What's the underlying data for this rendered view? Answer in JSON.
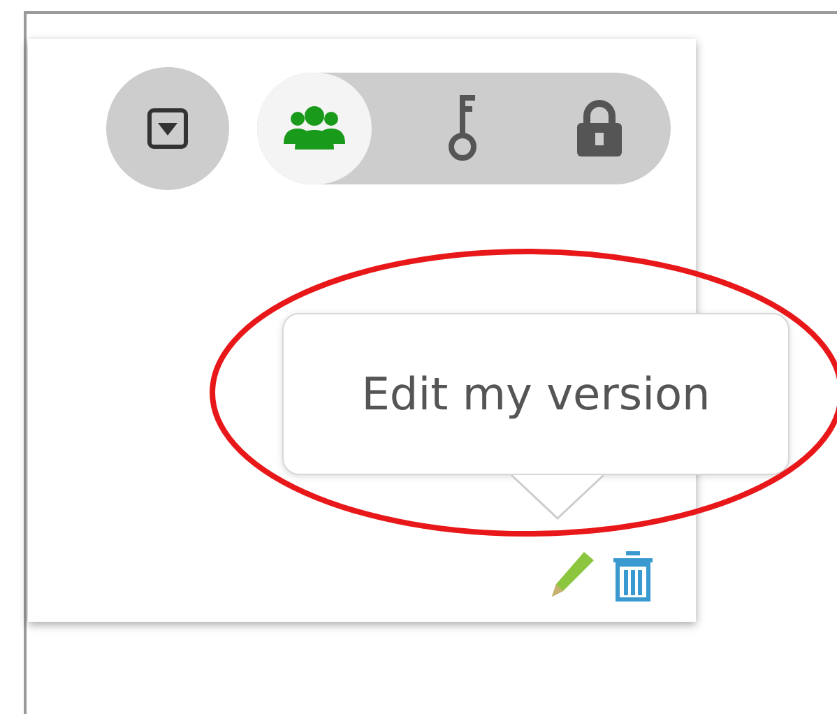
{
  "toolbar": {
    "menu_button": {
      "kind": "dropdown"
    },
    "toggles": [
      {
        "kind": "people",
        "selected": true
      },
      {
        "kind": "key",
        "selected": false
      },
      {
        "kind": "lock",
        "selected": false
      }
    ]
  },
  "tooltip": {
    "text": "Edit my version"
  },
  "actions": [
    {
      "kind": "edit"
    },
    {
      "kind": "delete"
    }
  ]
}
